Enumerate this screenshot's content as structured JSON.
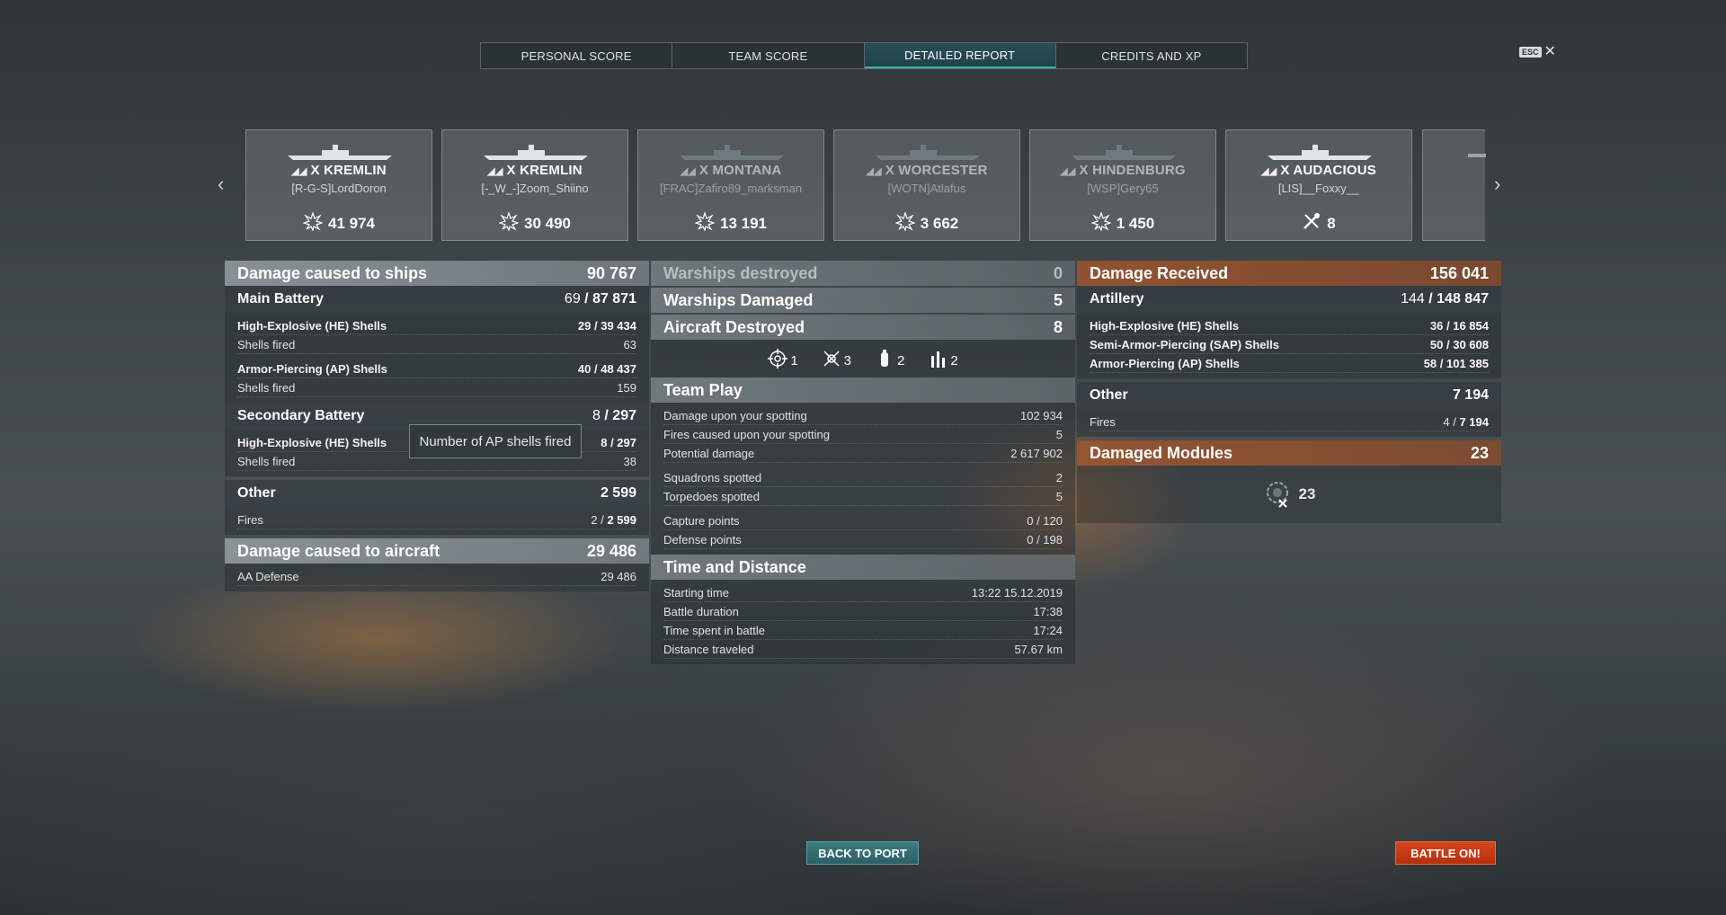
{
  "tabs": [
    {
      "label": "PERSONAL SCORE"
    },
    {
      "label": "TEAM SCORE"
    },
    {
      "label": "DETAILED REPORT"
    },
    {
      "label": "CREDITS AND XP"
    }
  ],
  "esc_label": "ESC",
  "ships": [
    {
      "tier": "X",
      "name": "KREMLIN",
      "player": "[R-G-S]LordDoron",
      "value": "41 974",
      "icon": "damage-icon"
    },
    {
      "tier": "X",
      "name": "KREMLIN",
      "player": "[-_W_-]Zoom_Shiino",
      "value": "30 490",
      "icon": "damage-icon"
    },
    {
      "tier": "X",
      "name": "MONTANA",
      "player": "[FRAC]Zafiro89_marksman",
      "value": "13 191",
      "icon": "damage-icon"
    },
    {
      "tier": "X",
      "name": "WORCESTER",
      "player": "[WOTN]Atlafus",
      "value": "3 662",
      "icon": "damage-icon"
    },
    {
      "tier": "X",
      "name": "HINDENBURG",
      "player": "[WSP]Gery65",
      "value": "1 450",
      "icon": "damage-icon"
    },
    {
      "tier": "X",
      "name": "AUDACIOUS",
      "player": "[LIS]__Foxxy__",
      "value": "8",
      "icon": "aircraft-destroyed-icon"
    }
  ],
  "left": {
    "header": {
      "label": "Damage caused to ships",
      "value": "90 767"
    },
    "main_battery": {
      "label": "Main Battery",
      "hits": "69",
      "total": "87 871"
    },
    "he": {
      "label": "High-Explosive (HE) Shells",
      "hits": "29",
      "total": "39 434"
    },
    "he_fired": {
      "label": "Shells fired",
      "value": "63"
    },
    "ap": {
      "label": "Armor-Piercing (AP) Shells",
      "hits": "40",
      "total": "48 437"
    },
    "ap_fired": {
      "label": "Shells fired",
      "value": "159"
    },
    "secondary": {
      "label": "Secondary Battery",
      "hits": "8",
      "total": "297"
    },
    "sec_he": {
      "label": "High-Explosive (HE) Shells",
      "hits": "8",
      "total": "297"
    },
    "sec_fired": {
      "label": "Shells fired",
      "value": "38"
    },
    "other": {
      "label": "Other",
      "value": "2 599"
    },
    "fires": {
      "label": "Fires",
      "hits": "2",
      "total": "2 599"
    },
    "aircraft": {
      "label": "Damage caused to aircraft",
      "value": "29 486"
    },
    "aa": {
      "label": "AA Defense",
      "value": "29 486"
    }
  },
  "tooltip": "Number of AP shells fired",
  "middle": {
    "destroyed": {
      "label": "Warships destroyed",
      "value": "0"
    },
    "damaged": {
      "label": "Warships Damaged",
      "value": "5"
    },
    "aircraft": {
      "label": "Aircraft Destroyed",
      "value": "8"
    },
    "icons": [
      {
        "name": "crosshair-icon",
        "value": "1"
      },
      {
        "name": "fire-icon",
        "value": "3"
      },
      {
        "name": "flooding-icon",
        "value": "2"
      },
      {
        "name": "citadel-icon",
        "value": "2"
      }
    ],
    "team_play": {
      "label": "Team Play"
    },
    "spot_dmg": {
      "label": "Damage upon your spotting",
      "value": "102 934"
    },
    "spot_fires": {
      "label": "Fires caused upon your spotting",
      "value": "5"
    },
    "potential": {
      "label": "Potential damage",
      "value": "2 617 902"
    },
    "squadrons": {
      "label": "Squadrons spotted",
      "value": "2"
    },
    "torpedoes": {
      "label": "Torpedoes spotted",
      "value": "5"
    },
    "capture": {
      "label": "Capture points",
      "value": "0 / 120"
    },
    "defense": {
      "label": "Defense points",
      "value": "0 / 198"
    },
    "time": {
      "label": "Time and Distance"
    },
    "start": {
      "label": "Starting time",
      "value": "13:22  15.12.2019"
    },
    "duration": {
      "label": "Battle duration",
      "value": "17:38"
    },
    "spent": {
      "label": "Time spent in battle",
      "value": "17:24"
    },
    "distance": {
      "label": "Distance traveled",
      "value": "57.67 km"
    }
  },
  "right": {
    "received": {
      "label": "Damage Received",
      "value": "156 041"
    },
    "artillery": {
      "label": "Artillery",
      "hits": "144",
      "total": "148 847"
    },
    "he": {
      "label": "High-Explosive (HE) Shells",
      "hits": "36",
      "total": "16 854"
    },
    "sap": {
      "label": "Semi-Armor-Piercing (SAP) Shells",
      "hits": "50",
      "total": "30 608"
    },
    "ap": {
      "label": "Armor-Piercing (AP) Shells",
      "hits": "58",
      "total": "101 385"
    },
    "other": {
      "label": "Other",
      "value": "7 194"
    },
    "fires": {
      "label": "Fires",
      "hits": "4",
      "total": "7 194"
    },
    "modules": {
      "label": "Damaged Modules",
      "value": "23"
    },
    "modules_icon_value": "23"
  },
  "buttons": {
    "back": "BACK TO PORT",
    "battle": "BATTLE ON!"
  }
}
